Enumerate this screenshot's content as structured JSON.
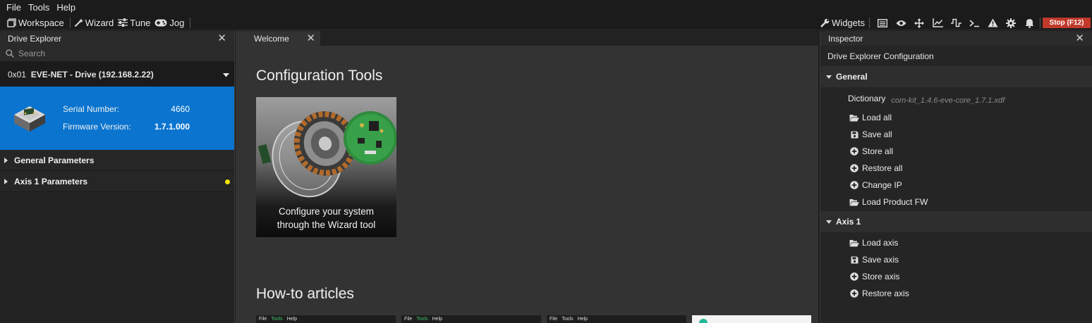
{
  "menu": {
    "items": [
      "File",
      "Tools",
      "Help"
    ]
  },
  "toolbar": {
    "workspace_label": "Workspace",
    "wizard_label": "Wizard",
    "tune_label": "Tune",
    "jog_label": "Jog",
    "widgets_label": "Widgets",
    "stop_label": "Stop (F12)",
    "icons": [
      "list-icon",
      "eye-icon",
      "move-icon",
      "chart-icon",
      "signal-icon",
      "terminal-icon",
      "warning-icon",
      "gear-icon",
      "bell-icon"
    ],
    "stop_color": "#c0392b"
  },
  "drive_explorer": {
    "title": "Drive Explorer",
    "search_placeholder": "Search",
    "drive_id": "0x01",
    "drive_name": "EVE-NET - Drive (192.168.2.22)",
    "serial_label": "Serial Number:",
    "serial_value": "4660",
    "firmware_label": "Firmware Version:",
    "firmware_value": "1.7.1.000",
    "card_color": "#0a74cf",
    "tree": [
      {
        "label": "General Parameters",
        "flag": false
      },
      {
        "label": "Axis 1 Parameters",
        "flag": true
      }
    ]
  },
  "center": {
    "tab_label": "Welcome",
    "config_title": "Configuration Tools",
    "card_caption_line1": "Configure your system",
    "card_caption_line2": "through the Wizard tool",
    "howto_title": "How-to articles",
    "thumbs": [
      {
        "file": "File",
        "tools": "Tools",
        "help": "Help"
      },
      {
        "file": "File",
        "tools": "Tools",
        "help": "Help"
      },
      {
        "file": "File",
        "tools": "Tools",
        "help": "Help"
      }
    ]
  },
  "inspector": {
    "title": "Inspector",
    "subtitle": "Drive Explorer Configuration",
    "general_label": "General",
    "dictionary_label": "Dictionary",
    "dictionary_value": "com-kit_1.4.6-eve-core_1.7.1.xdf",
    "general_actions": [
      "Load all",
      "Save all",
      "Store all",
      "Restore all",
      "Change IP",
      "Load Product FW"
    ],
    "axis_label": "Axis 1",
    "axis_actions": [
      "Load axis",
      "Save axis",
      "Store axis",
      "Restore axis"
    ]
  }
}
